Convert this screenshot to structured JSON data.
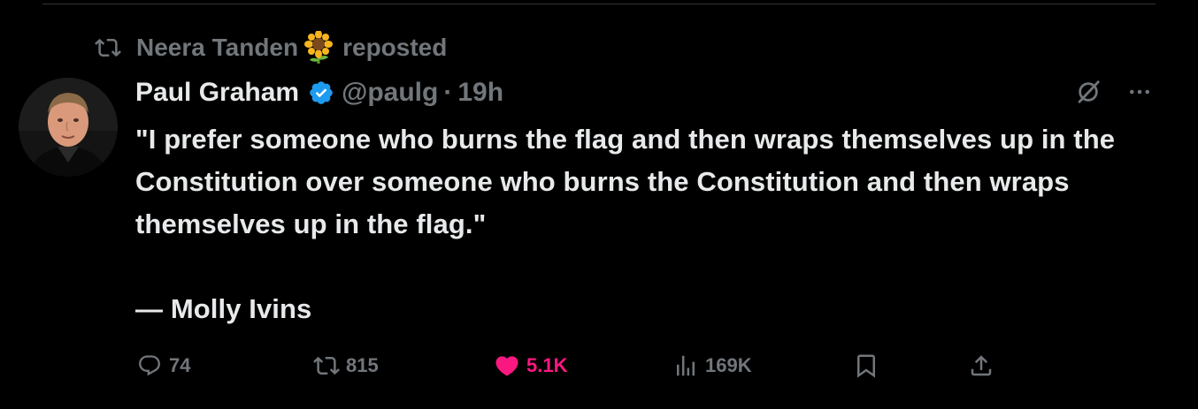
{
  "repost": {
    "user": "Neera Tanden",
    "emoji": "sunflower",
    "label": "reposted"
  },
  "post": {
    "author_name": "Paul Graham",
    "verified": true,
    "handle": "@paulg",
    "separator": "·",
    "time": "19h",
    "text_quote": "\"I prefer someone who burns the flag and then wraps themselves up in the Constitution over someone who burns the Constitution and then wraps themselves up in the flag.\"",
    "text_attribution": "— Molly Ivins"
  },
  "actions": {
    "replies": "74",
    "reposts": "815",
    "likes": "5.1K",
    "views": "169K"
  },
  "colors": {
    "background": "#000000",
    "text_primary": "#e7e9ea",
    "text_secondary": "#71767b",
    "verified_blue": "#1d9bf0",
    "like_pink": "#f91880",
    "divider": "#2f3336"
  },
  "icons": {
    "repost": "repost-icon",
    "verified": "verified-badge-icon",
    "grok": "grok-icon",
    "more": "more-icon",
    "reply": "reply-icon",
    "like": "heart-icon",
    "views": "views-icon",
    "bookmark": "bookmark-icon",
    "share": "share-icon"
  }
}
